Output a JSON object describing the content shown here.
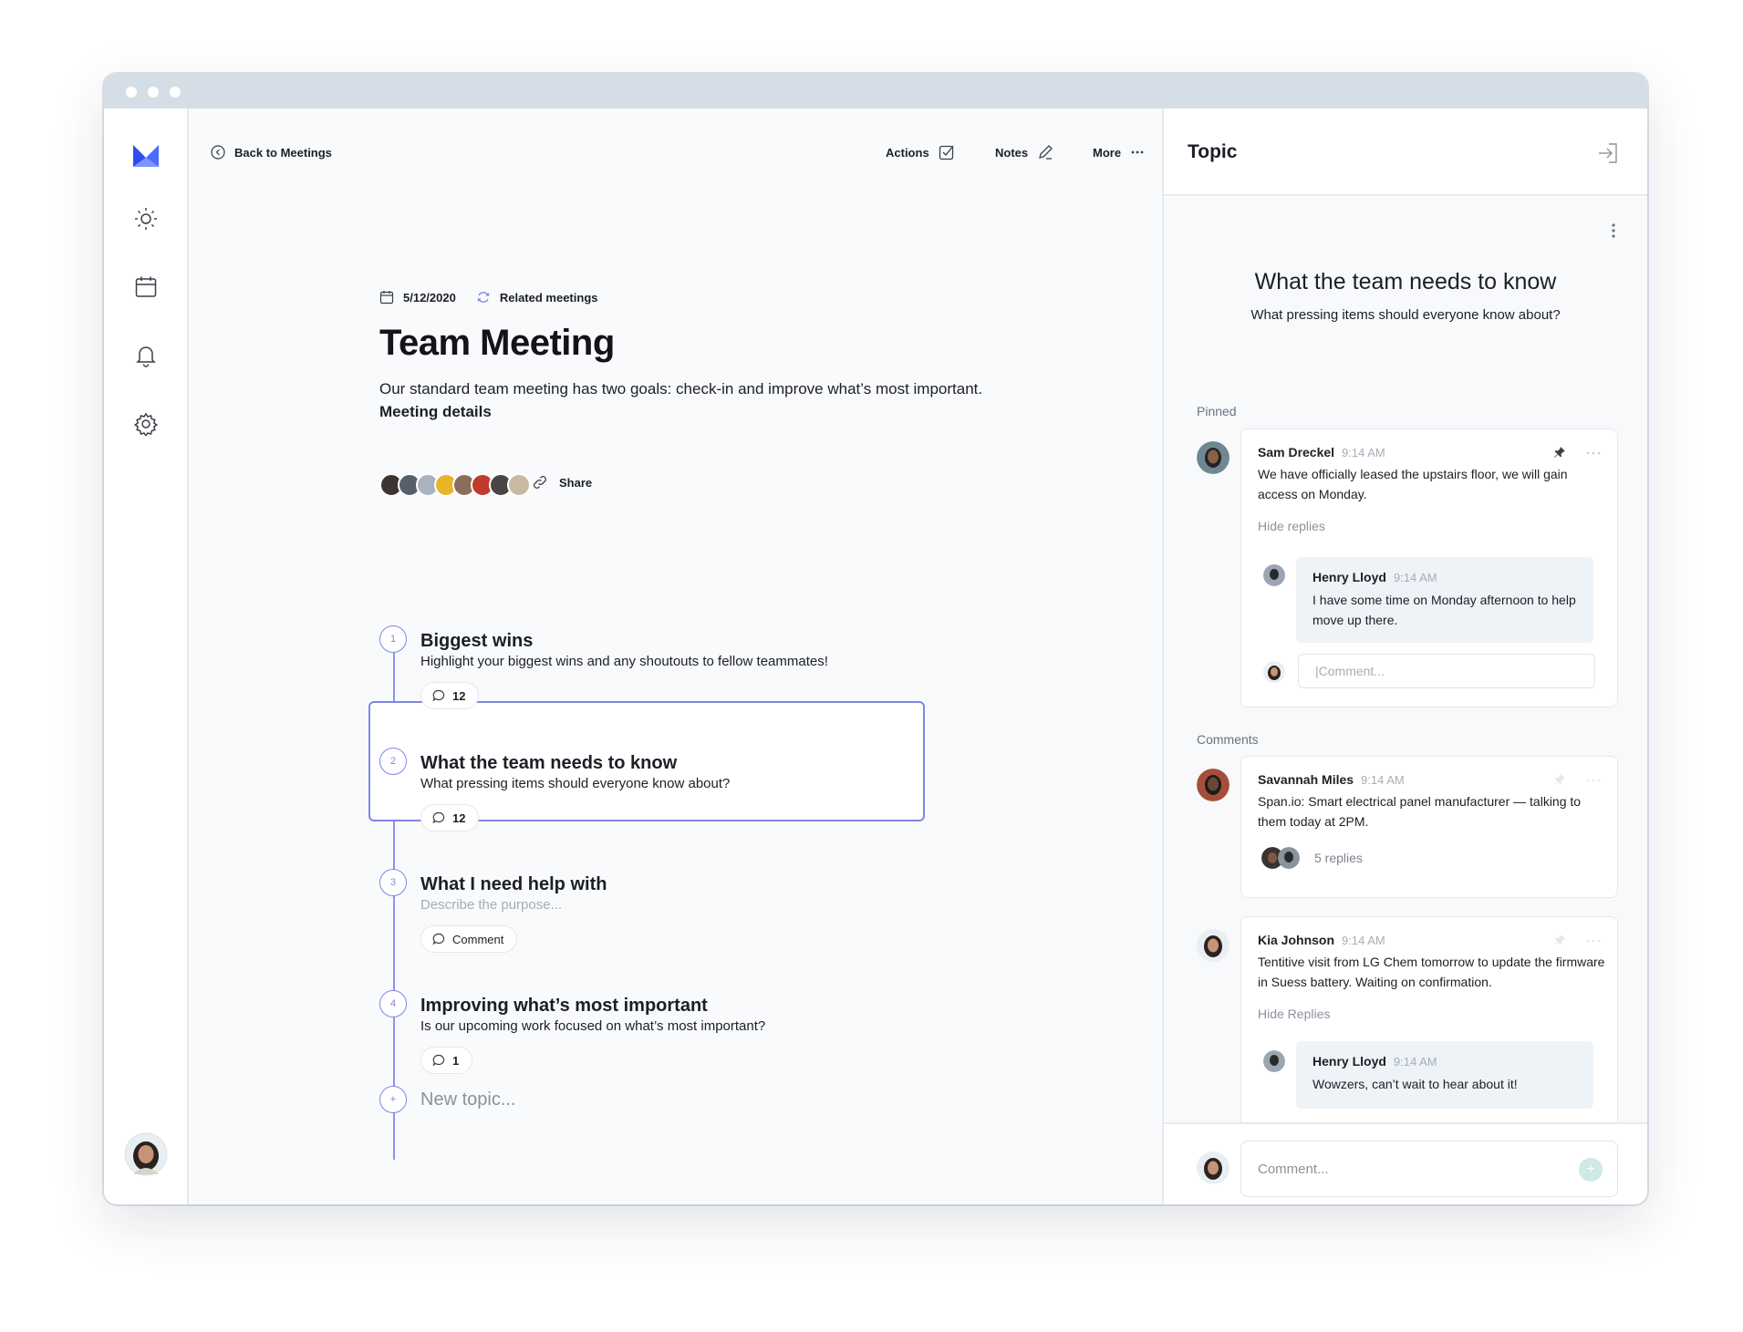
{
  "nav": {
    "back_label": "Back to Meetings",
    "actions_label": "Actions",
    "notes_label": "Notes",
    "more_label": "More"
  },
  "sidebar": {
    "items": [
      {
        "icon": "sun-icon"
      },
      {
        "icon": "calendar-icon"
      },
      {
        "icon": "bell-icon"
      },
      {
        "icon": "gear-icon"
      }
    ]
  },
  "meeting": {
    "date": "5/12/2020",
    "related_label": "Related meetings",
    "title": "Team Meeting",
    "description": "Our standard team meeting has two goals: check-in and improve what’s most important.",
    "details_link": "Meeting details",
    "share_label": "Share"
  },
  "topics": [
    {
      "number": "1",
      "title": "Biggest wins",
      "subtitle": "Highlight your biggest wins and any shoutouts to fellow teammates!",
      "comments": "12"
    },
    {
      "number": "2",
      "title": "What the team needs to know",
      "subtitle": "What pressing items should everyone know about?",
      "comments": "12"
    },
    {
      "number": "3",
      "title": "What I need help with",
      "subtitle": "Describe the purpose...",
      "comments": "Comment"
    },
    {
      "number": "4",
      "title": "Improving what’s most important",
      "subtitle": "Is our upcoming work focused on what’s most important?",
      "comments": "1"
    }
  ],
  "new_topic_placeholder": "New topic...",
  "panel": {
    "header": "Topic",
    "topic_title": "What the team needs to know",
    "topic_subtitle": "What pressing items should everyone know about?",
    "pinned_label": "Pinned",
    "comments_label": "Comments",
    "pinned": {
      "name": "Sam Dreckel",
      "time": "9:14 AM",
      "text": "We have officially leased the upstairs floor, we will gain access on Monday.",
      "hide_replies": "Hide replies",
      "reply": {
        "name": "Henry Lloyd",
        "time": "9:14 AM",
        "text": "I have some time on Monday afternoon to help move up there."
      },
      "reply_placeholder": "|Comment..."
    },
    "comments": [
      {
        "name": "Savannah Miles",
        "time": "9:14 AM",
        "text": "Span.io: Smart electrical panel manufacturer — talking to them today at 2PM.",
        "replies": "5 replies"
      },
      {
        "name": "Kia Johnson",
        "time": "9:14 AM",
        "text": "Tentitive visit from LG Chem tomorrow to update the firmware in Suess battery. Waiting on confirmation.",
        "hide_replies": "Hide Replies",
        "reply": {
          "name": "Henry Lloyd",
          "time": "9:14 AM",
          "text": "Wowzers, can’t wait to hear about it!"
        }
      }
    ],
    "comment_placeholder": "Comment..."
  },
  "colors": {
    "accent": "#7f86e6",
    "logo_blue": "#3b5bff",
    "titlebar": "#d5dee6"
  }
}
